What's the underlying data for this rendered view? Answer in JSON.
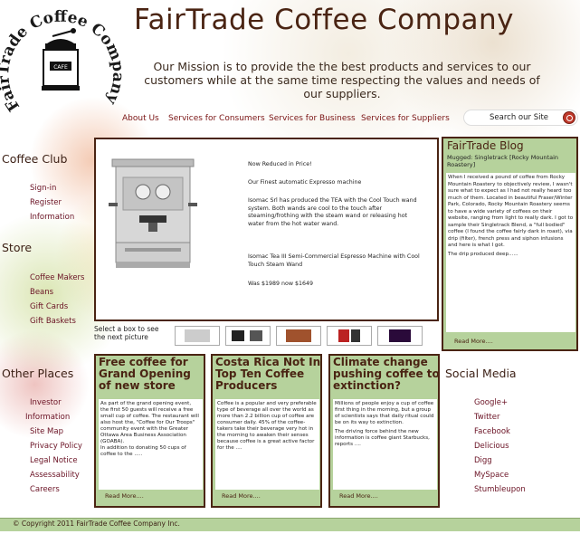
{
  "logo": {
    "ring_text": "FairTrade Coffee Company Inc.",
    "grinder_label": "CAFE"
  },
  "header": {
    "title": "FairTrade Coffee Company",
    "mission": "Our Mission is to provide the the best products and services to our customers while at the same time respecting the values and needs of our suppliers."
  },
  "nav": {
    "items": [
      "About Us",
      "Services for Consumers",
      "Services for Business",
      "Services for Suppliers"
    ]
  },
  "search": {
    "placeholder": "Search our Site",
    "icon": "search-icon"
  },
  "sidebar": {
    "coffee_club": {
      "heading": "Coffee Club",
      "links": [
        "Sign-in",
        "Register",
        "Information"
      ]
    },
    "store": {
      "heading": "Store",
      "links": [
        "Coffee Makers",
        "Beans",
        "Gift Cards",
        "Gift Baskets"
      ]
    },
    "select_hint": "Select a box to see the next picture",
    "other_places": {
      "heading": "Other Places",
      "links": [
        "Investor",
        "Information",
        "Site Map",
        "Privacy Policy",
        "Legal Notice",
        "Assessability",
        "Careers"
      ]
    }
  },
  "hero": {
    "line1": "Now Reduced in Price!",
    "line2": "Our Finest automatic Expresso machine",
    "line3": "Isomac Srl has produced  the TEA with the Cool Touch wand system. Both wands are cool to the touch after steaming/frothing with the steam wand or releasing hot water from the hot water wand.",
    "line4": "Isomac Tea III Semi-Commercial Espresso Machine with Cool Touch Steam Wand",
    "line5": "Was $1989 now $1649"
  },
  "blog": {
    "heading": "FairTrade Blog",
    "subheading": "Mugged: Singletrack [Rocky Mountain Roastery]",
    "body": "When I received a pound of coffee from Rocky Mountain Roastery to objectively review, I wasn't sure what to expect as I had not really heard too much of them. Located in beautiful Fraser/Winter Park, Colorado, Rocky Mountain Roastery seems to have a wide variety of coffees on their website, ranging from light to really dark. I got to sample their Singletrack Blend, a \"full bodied\" coffee (I found the coffee fairly dark in roast), via drip (filter), french press and siphon infusions and here is what I got.",
    "body2": "The drip produced deep......",
    "read_more": "Read More...."
  },
  "cards": [
    {
      "title": "Free coffee for Grand Opening of new store",
      "body": "As part of the grand opening event, the first 50 guests will receive a free small cup of coffee. The restaurant will also host the, \"Coffee for Our Troops\" community event with the Greater Ottawa Area Business Association (GOABA).",
      "body2": "In addition to donating 50 cups of coffee to the .....",
      "read_more": "Read More...."
    },
    {
      "title": "Costa Rica Not In Top Ten Coffee Producers",
      "body": "Coffee is a popular and very preferable type of beverage all over the world as more than 2.2 billion cup of coffee are consumer daily. 45% of the coffee-takers take their beverage very hot in the morning to awaken their senses because coffee is a great active factor for the ....",
      "body2": "",
      "read_more": "Read More...."
    },
    {
      "title": "Climate change pushing coffee to extinction?",
      "body": "Millions of people enjoy a cup of coffee first thing in the morning, but a group of scientists says that daily ritual could be on its way to extinction.",
      "body2": "The driving force behind the new information is coffee giant Starbucks, reports ....",
      "read_more": "Read More...."
    }
  ],
  "social": {
    "heading": "Social Media",
    "links": [
      "Google+",
      "Twitter",
      "Facebook",
      "Delicious",
      "Digg",
      "MySpace",
      "Stumbleupon"
    ]
  },
  "footer": {
    "copyright": "© Copyright 2011 FairTrade Coffee Company Inc."
  },
  "colors": {
    "accent_green": "#b6d29c",
    "brown": "#4a2413",
    "link_maroon": "#6a1224"
  }
}
